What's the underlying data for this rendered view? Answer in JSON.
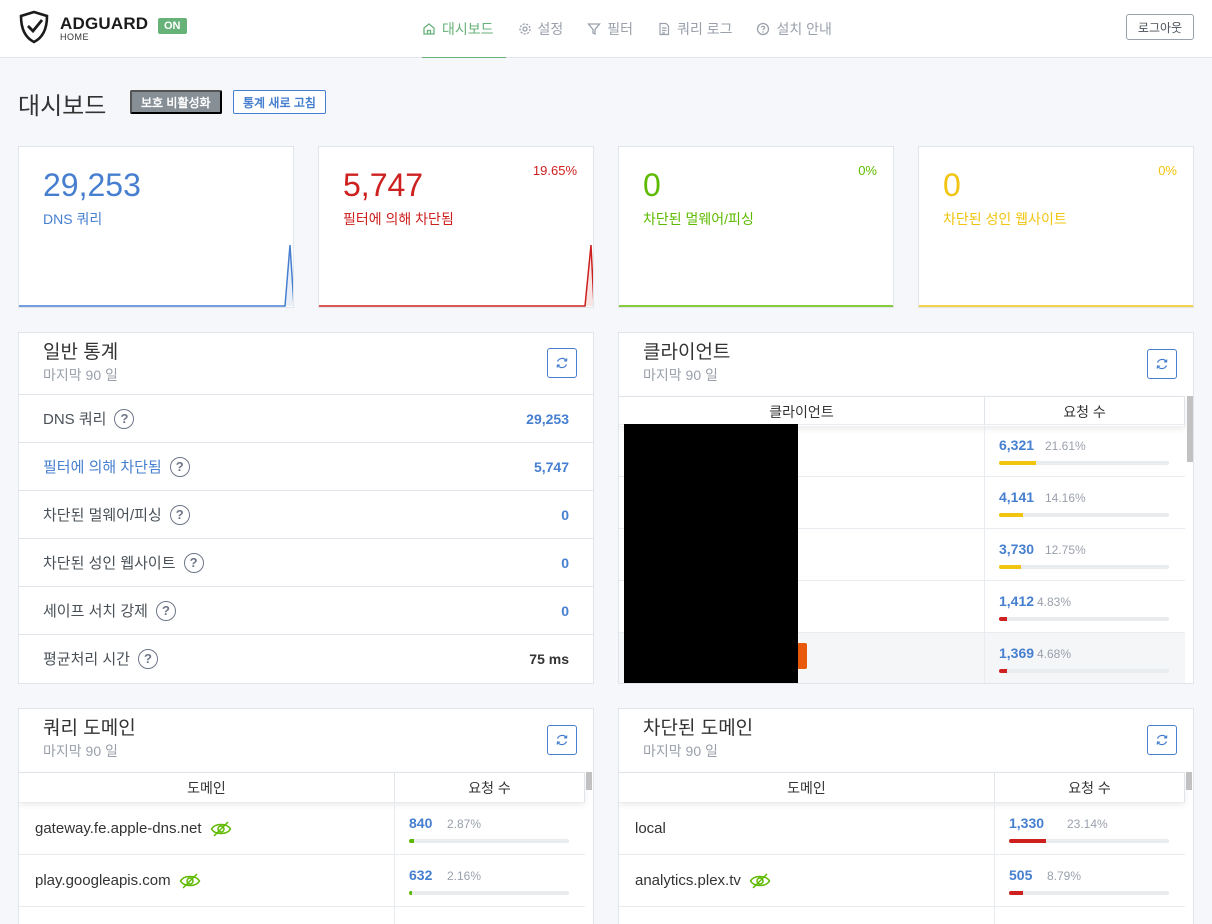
{
  "brand": {
    "name": "ADGUARD",
    "sub": "HOME",
    "status": "ON"
  },
  "nav": [
    {
      "label": "대시보드",
      "icon": "home-icon",
      "active": true
    },
    {
      "label": "설정",
      "icon": "gear-icon"
    },
    {
      "label": "필터",
      "icon": "filter-icon"
    },
    {
      "label": "쿼리 로그",
      "icon": "document-icon"
    },
    {
      "label": "설치 안내",
      "icon": "help-circle-icon"
    }
  ],
  "logout": "로그아웃",
  "page": {
    "title": "대시보드",
    "disable_btn": "보호 비활성화",
    "refresh_btn": "통계 새로 고침"
  },
  "stats": [
    {
      "value": "29,253",
      "label": "DNS 쿼리",
      "pct": "",
      "color": "#467fcf"
    },
    {
      "value": "5,747",
      "label": "필터에 의해 차단됨",
      "pct": "19.65%",
      "color": "#cd201f"
    },
    {
      "value": "0",
      "label": "차단된 멀웨어/피싱",
      "pct": "0%",
      "color": "#5eba00"
    },
    {
      "value": "0",
      "label": "차단된 성인 웹사이트",
      "pct": "0%",
      "color": "#f1c40f"
    }
  ],
  "general": {
    "title": "일반 통계",
    "subtitle": "마지막 90 일",
    "rows": [
      {
        "label": "DNS 쿼리",
        "value": "29,253"
      },
      {
        "label": "필터에 의해 차단됨",
        "value": "5,747"
      },
      {
        "label": "차단된 멀웨어/피싱",
        "value": "0"
      },
      {
        "label": "차단된 성인 웹사이트",
        "value": "0"
      },
      {
        "label": "세이프 서치 강제",
        "value": "0"
      },
      {
        "label": "평균처리 시간",
        "value": "75 ms"
      }
    ]
  },
  "clients": {
    "title": "클라이언트",
    "subtitle": "마지막 90 일",
    "col1": "클라이언트",
    "col2": "요청 수",
    "rows": [
      {
        "count": "6,321",
        "pct": "21.61%",
        "frac": 0.2161
      },
      {
        "count": "4,141",
        "pct": "14.16%",
        "frac": 0.1416
      },
      {
        "count": "3,730",
        "pct": "12.75%",
        "frac": 0.1275
      },
      {
        "count": "1,412",
        "pct": "4.83%",
        "frac": 0.0483
      },
      {
        "count": "1,369",
        "pct": "4.68%",
        "frac": 0.0468
      }
    ]
  },
  "query_domains": {
    "title": "쿼리 도메인",
    "subtitle": "마지막 90 일",
    "col1": "도메인",
    "col2": "요청 수",
    "rows": [
      {
        "domain": "gateway.fe.apple-dns.net",
        "count": "840",
        "pct": "2.87%",
        "frac": 0.0287
      },
      {
        "domain": "play.googleapis.com",
        "count": "632",
        "pct": "2.16%",
        "frac": 0.0216
      }
    ]
  },
  "blocked_domains": {
    "title": "차단된 도메인",
    "subtitle": "마지막 90 일",
    "col1": "도메인",
    "col2": "요청 수",
    "rows": [
      {
        "domain": "local",
        "count": "1,330",
        "pct": "23.14%",
        "frac": 0.2314
      },
      {
        "domain": "analytics.plex.tv",
        "count": "505",
        "pct": "8.79%",
        "frac": 0.0879
      }
    ]
  },
  "colors": {
    "accent": "#67b279",
    "primary": "#467fcf",
    "danger": "#cd201f",
    "warning": "#f1c40f",
    "success": "#5eba00"
  }
}
